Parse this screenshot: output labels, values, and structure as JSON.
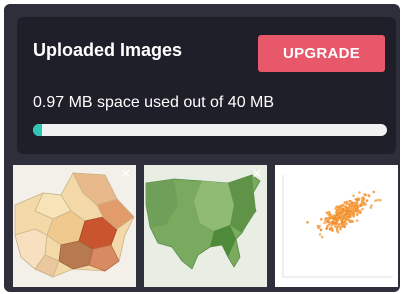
{
  "uploads": {
    "title": "Uploaded Images",
    "upgrade_label": "UPGRADE",
    "usage_text": "0.97 MB space used out of 40 MB",
    "usage_fraction": 0.02425,
    "accent_color": "#e8586b",
    "progress_color": "#2ec4b6",
    "images": [
      {
        "icon": "county-choropleth-map-thumbnail",
        "close_icon": "close-icon"
      },
      {
        "icon": "us-dot-density-map-thumbnail",
        "close_icon": "close-icon"
      },
      {
        "icon": "scatter-plot-thumbnail",
        "close_icon": "close-icon"
      }
    ]
  }
}
